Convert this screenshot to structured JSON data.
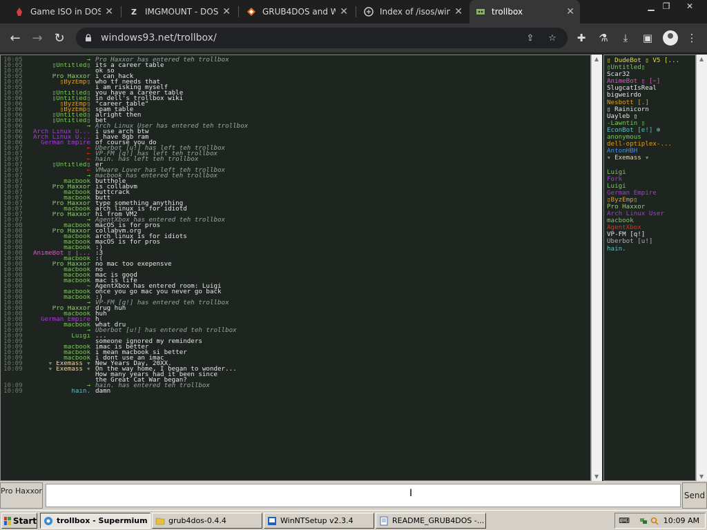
{
  "colors": {
    "green": "#7ec85a",
    "orange": "#e0a020",
    "purple": "#a040d0",
    "red": "#e03020",
    "blue": "#4a8fe0",
    "grey": "#b0b0b0",
    "white": "#e8e8e8",
    "cyan": "#60c0c0",
    "yellow": "#e0e030",
    "lgreen": "#90d070",
    "pink": "#d060c0",
    "cream": "#e8d8b0"
  },
  "browser": {
    "tabs": [
      {
        "title": "Game ISO in DOSBo",
        "icon": "dosbox-icon"
      },
      {
        "title": "IMGMOUNT - DOSB",
        "icon": "z-icon"
      },
      {
        "title": "GRUB4DOS and W",
        "icon": "gitlab-icon"
      },
      {
        "title": "Index of /isos/windo",
        "icon": "folder-icon"
      },
      {
        "title": "trollbox",
        "icon": "trollbox-icon"
      }
    ],
    "url": "windows93.net/trollbox/"
  },
  "chat": {
    "messages": [
      {
        "time": "10:05",
        "nick": "→",
        "nc": "green",
        "text": "Pro Haxxor has entered teh trollbox",
        "sys": true
      },
      {
        "time": "10:05",
        "nick": "▯Untitled▯",
        "nc": "green",
        "text": "its a career table"
      },
      {
        "time": "10:05",
        "nick": "",
        "nc": "green",
        "text": "ok so"
      },
      {
        "time": "10:05",
        "nick": "Pro Haxxor",
        "nc": "lgreen",
        "text": "i can hack"
      },
      {
        "time": "10:05",
        "nick": "▯ByzEmp▯",
        "nc": "orange",
        "text": "who tf needs that"
      },
      {
        "time": "10:05",
        "nick": "",
        "nc": "green",
        "text": "i am risking myself"
      },
      {
        "time": "10:05",
        "nick": "▯Untitled▯",
        "nc": "green",
        "text": "you have a career table"
      },
      {
        "time": "10:06",
        "nick": "▯Untitled▯",
        "nc": "green",
        "text": "in dell's trollbox wiki"
      },
      {
        "time": "10:06",
        "nick": "▯ByzEmp▯",
        "nc": "orange",
        "text": "\"career table\""
      },
      {
        "time": "10:06",
        "nick": "▯ByzEmp▯",
        "nc": "orange",
        "text": "spam table"
      },
      {
        "time": "10:06",
        "nick": "▯Untitled▯",
        "nc": "green",
        "text": "alright then"
      },
      {
        "time": "10:06",
        "nick": "▯Untitled▯",
        "nc": "green",
        "text": "bet"
      },
      {
        "time": "10:06",
        "nick": "→",
        "nc": "green",
        "text": "Arch Linux User has entered teh trollbox",
        "sys": true
      },
      {
        "time": "10:06",
        "nick": "Arch Linux U...",
        "nc": "purple",
        "text": "i use arch btw"
      },
      {
        "time": "10:06",
        "nick": "Arch Linux U...",
        "nc": "purple",
        "text": "i have 8gb ram"
      },
      {
        "time": "10:06",
        "nick": "German Empire",
        "nc": "purple",
        "text": "of course you do"
      },
      {
        "time": "10:07",
        "nick": "←",
        "nc": "red",
        "text": "Uberbot [u!] has left teh trollbox",
        "sys": true
      },
      {
        "time": "10:07",
        "nick": "←",
        "nc": "red",
        "text": "VP-FM [q!] has left teh trollbox",
        "sys": true
      },
      {
        "time": "10:07",
        "nick": "←",
        "nc": "red",
        "text": "hain. has left teh trollbox",
        "sys": true
      },
      {
        "time": "10:07",
        "nick": "▯Untitled▯",
        "nc": "green",
        "text": "er"
      },
      {
        "time": "10:07",
        "nick": "←",
        "nc": "red",
        "text": "VMware Lover has left teh trollbox",
        "sys": true
      },
      {
        "time": "10:07",
        "nick": "→",
        "nc": "green",
        "text": "macbook has entered teh trollbox",
        "sys": true
      },
      {
        "time": "10:07",
        "nick": "macbook",
        "nc": "green",
        "text": "butthole"
      },
      {
        "time": "10:07",
        "nick": "Pro Haxxor",
        "nc": "lgreen",
        "text": "is collabvm"
      },
      {
        "time": "10:07",
        "nick": "macbook",
        "nc": "green",
        "text": "buttcrack"
      },
      {
        "time": "10:07",
        "nick": "macbook",
        "nc": "green",
        "text": "butt"
      },
      {
        "time": "10:07",
        "nick": "Pro Haxxor",
        "nc": "lgreen",
        "text": "type something anything"
      },
      {
        "time": "10:07",
        "nick": "macbook",
        "nc": "green",
        "text": "arch linux is for idiotd"
      },
      {
        "time": "10:07",
        "nick": "Pro Haxxor",
        "nc": "lgreen",
        "text": "hi from VM2"
      },
      {
        "time": "10:07",
        "nick": "→",
        "nc": "green",
        "text": "AgentXbox has entered teh trollbox",
        "sys": true
      },
      {
        "time": "10:08",
        "nick": "macbook",
        "nc": "green",
        "text": "macOS is for pros"
      },
      {
        "time": "10:08",
        "nick": "Pro Haxxor",
        "nc": "lgreen",
        "text": "collabvm.org"
      },
      {
        "time": "10:08",
        "nick": "macbook",
        "nc": "green",
        "text": "arch linux is for idiots"
      },
      {
        "time": "10:08",
        "nick": "macbook",
        "nc": "green",
        "text": "macOS is for pros"
      },
      {
        "time": "10:08",
        "nick": "macbook",
        "nc": "green",
        "text": ":)"
      },
      {
        "time": "10:08",
        "nick": "AnimeBot ▯ [...",
        "nc": "pink",
        "text": ":3"
      },
      {
        "time": "10:08",
        "nick": "macbook",
        "nc": "green",
        "text": ":("
      },
      {
        "time": "10:08",
        "nick": "Pro Haxxor",
        "nc": "lgreen",
        "text": "no mac too exepensve"
      },
      {
        "time": "10:08",
        "nick": "macbook",
        "nc": "green",
        "text": "no"
      },
      {
        "time": "10:08",
        "nick": "macbook",
        "nc": "green",
        "text": "mac is good"
      },
      {
        "time": "10:08",
        "nick": "macbook",
        "nc": "green",
        "text": "mac is life"
      },
      {
        "time": "10:08",
        "nick": "~",
        "nc": "green",
        "text": "AgentXbox has entered room: Luigi",
        "room": true
      },
      {
        "time": "10:08",
        "nick": "macbook",
        "nc": "green",
        "text": "once you go mac you never go back"
      },
      {
        "time": "10:08",
        "nick": "macbook",
        "nc": "green",
        "text": ":)"
      },
      {
        "time": "10:08",
        "nick": "→",
        "nc": "green",
        "text": "VP-FM [q!] has entered teh trollbox",
        "sys": true
      },
      {
        "time": "10:08",
        "nick": "Pro Haxxor",
        "nc": "lgreen",
        "text": "drug huh"
      },
      {
        "time": "10:08",
        "nick": "macbook",
        "nc": "green",
        "text": "huh"
      },
      {
        "time": "10:08",
        "nick": "German Empire",
        "nc": "purple",
        "text": "h"
      },
      {
        "time": "10:08",
        "nick": "macbook",
        "nc": "green",
        "text": "what dru"
      },
      {
        "time": "10:09",
        "nick": "→",
        "nc": "green",
        "text": "Uberbot [u!] has entered teh trollbox",
        "sys": true
      },
      {
        "time": "10:09",
        "nick": "Luigi",
        "nc": "green",
        "text": "..."
      },
      {
        "time": "10:09",
        "nick": "",
        "nc": "green",
        "text": "someone ignored my reminders"
      },
      {
        "time": "10:09",
        "nick": "macbook",
        "nc": "green",
        "text": "imac is better"
      },
      {
        "time": "10:09",
        "nick": "macbook",
        "nc": "green",
        "text": "i mean macbook si better"
      },
      {
        "time": "10:09",
        "nick": "macbook",
        "nc": "green",
        "text": "i dont use an imac"
      },
      {
        "time": "10:09",
        "nick": "▿ Exemass ▿",
        "nc": "cream",
        "text": "New Years Day, 20XX."
      },
      {
        "time": "10:09",
        "nick": "▿ Exemass ▿",
        "nc": "cream",
        "text": "On the way home, I began to wonder..."
      },
      {
        "time": "",
        "nick": "",
        "nc": "green",
        "text": "How many years had it been since"
      },
      {
        "time": "",
        "nick": "",
        "nc": "green",
        "text": "the Great Cat War began?"
      },
      {
        "time": "10:09",
        "nick": "→",
        "nc": "green",
        "text": "hain. has entered teh trollbox",
        "sys": true
      },
      {
        "time": "10:09",
        "nick": "hain.",
        "nc": "cyan",
        "text": "damn"
      }
    ]
  },
  "users": [
    {
      "name": "▯ DudeBot ▯ V5 [...",
      "c": "yellow"
    },
    {
      "name": "▯Untitled▯",
      "c": "green"
    },
    {
      "name": "Scar32",
      "c": "white"
    },
    {
      "name": "AnimeBot ▯ [~]",
      "c": "pink"
    },
    {
      "name": "SlugcatIsReal",
      "c": "white"
    },
    {
      "name": "bigweirdo",
      "c": "white"
    },
    {
      "name": "Nesbott [.]",
      "c": "orange"
    },
    {
      "name": "▯ Rainicorn",
      "c": "white"
    },
    {
      "name": "Uayleb ▯",
      "c": "white"
    },
    {
      "name": "-Lawntin ▯",
      "c": "green"
    },
    {
      "name": "EconBot [e!] ❄",
      "c": "cyan"
    },
    {
      "name": "anonymous",
      "c": "green"
    },
    {
      "name": "dell-optiplex-...",
      "c": "orange"
    },
    {
      "name": "AntonHBH",
      "c": "blue"
    },
    {
      "name": "▿ Exemass ▿",
      "c": "cream"
    },
    {
      "name": "",
      "c": "white"
    },
    {
      "name": "Luigi",
      "c": "green"
    },
    {
      "name": "Fork",
      "c": "purple"
    },
    {
      "name": "Luigi",
      "c": "green"
    },
    {
      "name": "German Empire",
      "c": "purple"
    },
    {
      "name": "▯ByzEmp▯",
      "c": "orange"
    },
    {
      "name": "Pro Haxxor",
      "c": "lgreen"
    },
    {
      "name": "Arch Linux User",
      "c": "purple"
    },
    {
      "name": "macbook",
      "c": "green"
    },
    {
      "name": "AgentXbox",
      "c": "red"
    },
    {
      "name": "VP-FM [q!]",
      "c": "white"
    },
    {
      "name": "Uberbot [u!]",
      "c": "grey"
    },
    {
      "name": "hain.",
      "c": "cyan"
    }
  ],
  "input": {
    "nick": "Pro Haxxor",
    "value": "",
    "send": "Send"
  },
  "taskbar": {
    "start": "Start",
    "tasks": [
      {
        "label": "trollbox - Supermium",
        "active": true,
        "icon": "browser-icon"
      },
      {
        "label": "grub4dos-0.4.4",
        "active": false,
        "icon": "folder-icon"
      },
      {
        "label": "WinNTSetup v2.3.4",
        "active": false,
        "icon": "app-icon"
      },
      {
        "label": "README_GRUB4DOS -...",
        "active": false,
        "icon": "notepad-icon"
      }
    ],
    "clock": "10:09 AM"
  }
}
